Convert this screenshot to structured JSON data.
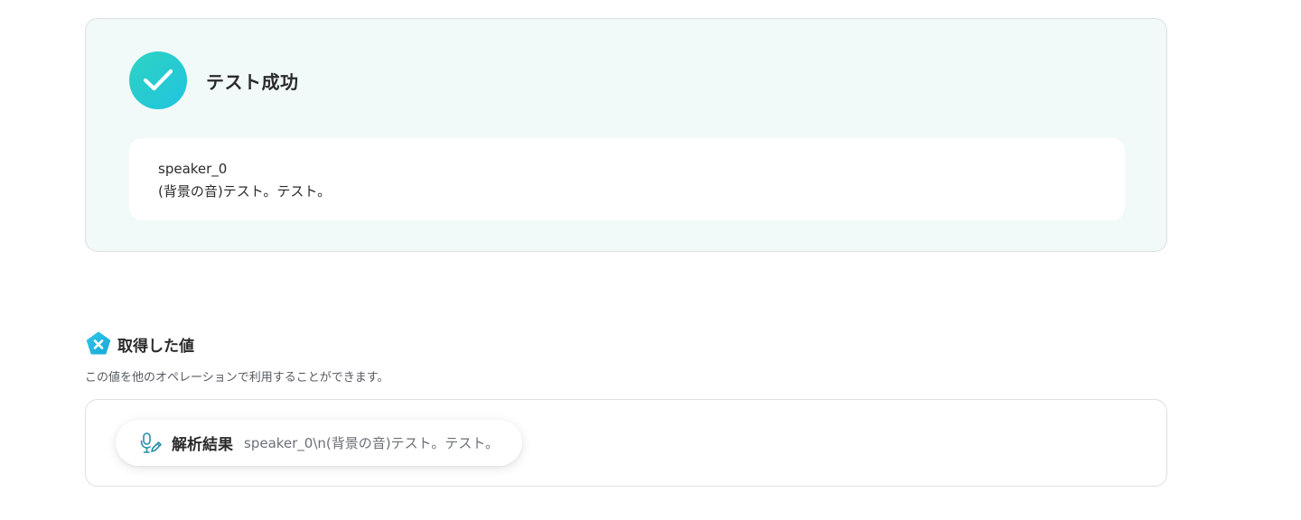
{
  "success": {
    "title": "テスト成功",
    "icon": "check-icon",
    "result_lines": [
      "speaker_0",
      "(背景の音)テスト。テスト。"
    ]
  },
  "values": {
    "title": "取得した値",
    "icon": "variable-badge-icon",
    "description": "この値を他のオペレーションで利用することができます。",
    "items": [
      {
        "label": "解析結果",
        "value": "speaker_0\\n(背景の音)テスト。テスト。",
        "icon": "microphone-pen-icon"
      }
    ]
  },
  "colors": {
    "accent_teal": "#2ed3c1",
    "accent_cyan": "#1fc4e0",
    "panel_bg": "#f2f9f9",
    "border": "#dcdfe3"
  }
}
